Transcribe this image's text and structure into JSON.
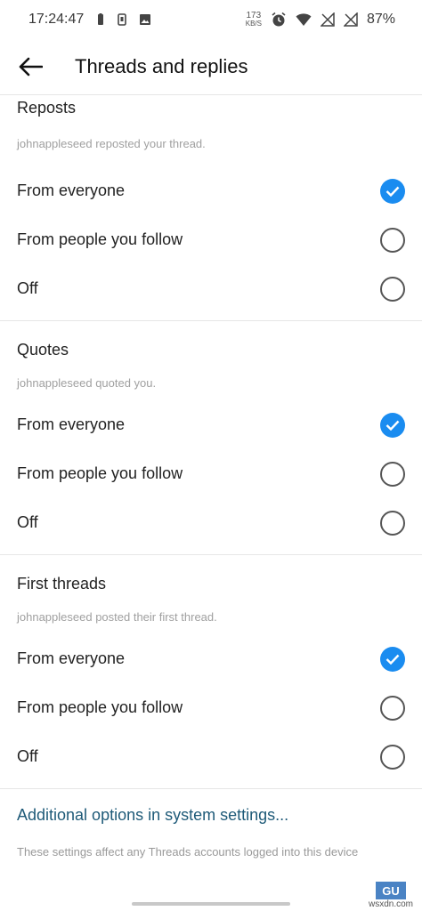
{
  "status_bar": {
    "time": "17:24:47",
    "speed_value": "173",
    "speed_unit": "KB/S",
    "battery": "87%"
  },
  "header": {
    "title": "Threads and replies"
  },
  "sections": [
    {
      "title": "Reposts",
      "hint": "johnappleseed reposted your thread.",
      "options": [
        {
          "label": "From everyone",
          "selected": true
        },
        {
          "label": "From people you follow",
          "selected": false
        },
        {
          "label": "Off",
          "selected": false
        }
      ]
    },
    {
      "title": "Quotes",
      "hint": "johnappleseed quoted you.",
      "options": [
        {
          "label": "From everyone",
          "selected": true
        },
        {
          "label": "From people you follow",
          "selected": false
        },
        {
          "label": "Off",
          "selected": false
        }
      ]
    },
    {
      "title": "First threads",
      "hint": "johnappleseed posted their first thread.",
      "options": [
        {
          "label": "From everyone",
          "selected": true
        },
        {
          "label": "From people you follow",
          "selected": false
        },
        {
          "label": "Off",
          "selected": false
        }
      ]
    }
  ],
  "footer": {
    "link": "Additional options in system settings...",
    "note": "These settings affect any Threads accounts logged into this device"
  },
  "watermark": {
    "logo": "GU",
    "text": "wsxdn.com"
  },
  "colors": {
    "accent": "#1a8cf0",
    "link": "#1e5a78"
  }
}
